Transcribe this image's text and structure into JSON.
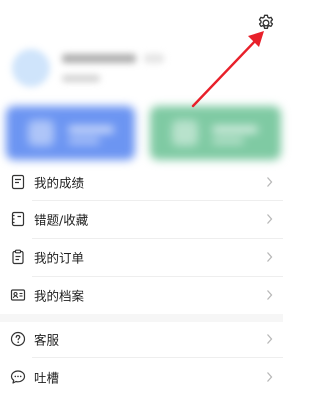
{
  "colors": {
    "card_blue": "#6c95f2",
    "card_green": "#7fcaa3",
    "arrow": "#e8202a",
    "text": "#1d1d1d",
    "chevron": "#b8b8b8"
  },
  "header": {
    "settings_icon": "gear-icon"
  },
  "menu": {
    "group1": [
      {
        "label": "我的成绩",
        "icon": "report-icon"
      },
      {
        "label": "错题/收藏",
        "icon": "book-icon"
      },
      {
        "label": "我的订单",
        "icon": "order-icon"
      },
      {
        "label": "我的档案",
        "icon": "profile-card-icon"
      }
    ],
    "group2": [
      {
        "label": "客服",
        "icon": "help-icon"
      },
      {
        "label": "吐槽",
        "icon": "chat-icon"
      }
    ]
  }
}
